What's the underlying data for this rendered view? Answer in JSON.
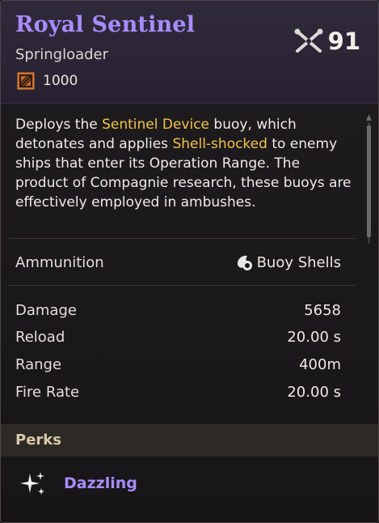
{
  "item": {
    "name": "Royal Sentinel",
    "type": "Springloader",
    "cost": "1000",
    "level": "91"
  },
  "description": {
    "part1": "Deploys the ",
    "highlight1": "Sentinel Device",
    "part2": " buoy, which detonates and applies ",
    "highlight2": "Shell-shocked",
    "part3": " to enemy ships that enter its Operation Range. The product of Compagnie research, these buoys are effectively employed in ambushes."
  },
  "ammunition": {
    "label": "Ammunition",
    "value": "Buoy Shells"
  },
  "stats": [
    {
      "label": "Damage",
      "value": "5658"
    },
    {
      "label": "Reload",
      "value": "20.00 s"
    },
    {
      "label": "Range",
      "value": "400m"
    },
    {
      "label": "Fire Rate",
      "value": "20.00 s"
    }
  ],
  "perks": {
    "title": "Perks",
    "items": [
      {
        "name": "Dazzling"
      }
    ]
  },
  "colors": {
    "title": "#a88cff",
    "highlight": "#f2c34a",
    "perk_name": "#a88cff",
    "perks_header_bg": "#2d2a26"
  },
  "icons": {
    "cost": "crate-icon",
    "level": "crossed-cannons-icon",
    "ammo": "shell-icon",
    "perk": "sparkle-icon"
  }
}
